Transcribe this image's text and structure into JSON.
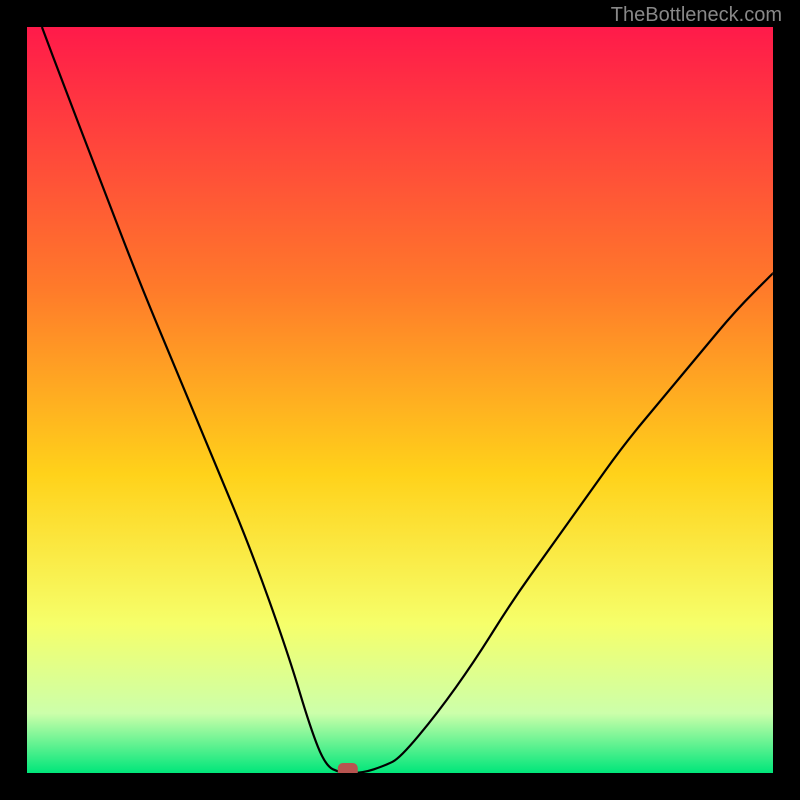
{
  "watermark": "TheBottleneck.com",
  "chart_data": {
    "type": "line",
    "title": "",
    "xlabel": "",
    "ylabel": "",
    "xlim": [
      0,
      100
    ],
    "ylim": [
      0,
      100
    ],
    "grid": false,
    "background": "rainbow-gradient",
    "series": [
      {
        "name": "bottleneck-curve",
        "description": "V-shaped bottleneck curve with minimum near x=42",
        "x": [
          2,
          5,
          10,
          15,
          20,
          25,
          30,
          35,
          38,
          40,
          42,
          45,
          48,
          50,
          55,
          60,
          65,
          70,
          75,
          80,
          85,
          90,
          95,
          100
        ],
        "y": [
          100,
          92,
          79,
          66,
          54,
          42,
          30,
          16,
          6,
          1,
          0,
          0,
          1,
          2,
          8,
          15,
          23,
          30,
          37,
          44,
          50,
          56,
          62,
          67
        ]
      }
    ],
    "marker": {
      "x": 43,
      "y": 0,
      "color": "#b85450",
      "shape": "rounded-rect"
    },
    "gradient_stops": [
      {
        "offset": 0,
        "color": "#ff1a4a"
      },
      {
        "offset": 35,
        "color": "#ff7a2a"
      },
      {
        "offset": 60,
        "color": "#ffd21a"
      },
      {
        "offset": 80,
        "color": "#f6ff6a"
      },
      {
        "offset": 92,
        "color": "#ccffaa"
      },
      {
        "offset": 100,
        "color": "#00e67a"
      }
    ]
  }
}
